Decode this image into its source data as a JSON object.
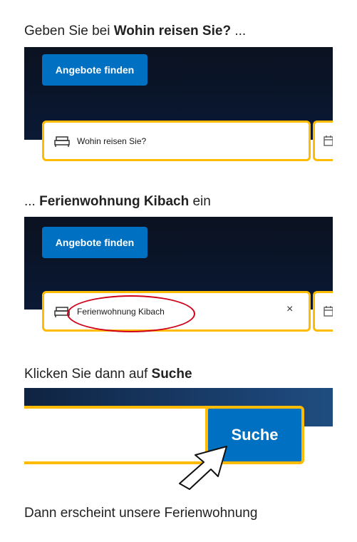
{
  "step1": {
    "prefix": "Geben Sie bei ",
    "bold": "Wohin reisen Sie?",
    "suffix": " ...",
    "offers_button": "Angebote finden",
    "search_placeholder": "Wohin reisen Sie?"
  },
  "step2": {
    "prefix": "... ",
    "bold": "Ferienwohnung Kibach",
    "suffix": " ein",
    "offers_button": "Angebote finden",
    "search_value": "Ferienwohnung Kibach",
    "clear_symbol": "×"
  },
  "step3": {
    "prefix": "Klicken Sie dann auf ",
    "bold": "Suche",
    "search_button": "Suche"
  },
  "final_text": "Dann erscheint unsere Ferienwohnung",
  "colors": {
    "accent_blue": "#0071c2",
    "highlight_yellow": "#febb02",
    "annotation_red": "#d0021b",
    "panel_dark": "#0b1220"
  },
  "icons": [
    "bed-icon",
    "calendar-icon",
    "cursor-arrow-icon"
  ]
}
